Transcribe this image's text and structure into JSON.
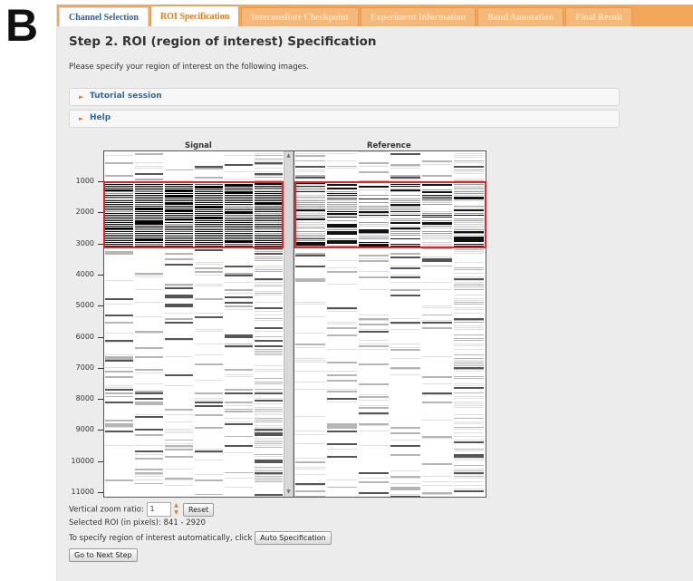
{
  "panel_label": "B",
  "tabs": [
    {
      "label": "Channel Selection"
    },
    {
      "label": "ROI Specification"
    },
    {
      "label": "Intermediate Checkpoint"
    },
    {
      "label": "Experiment Information"
    },
    {
      "label": "Band Annotation"
    },
    {
      "label": "Final Result"
    }
  ],
  "step_title": "Step 2. ROI (region of interest) Specification",
  "intro_text": "Please specify your region of interest on the following images.",
  "accordions": [
    {
      "label": "Tutorial session"
    },
    {
      "label": "Help"
    }
  ],
  "signal_title": "Signal",
  "reference_title": "Reference",
  "y_axis_ticks": [
    "1000",
    "2000",
    "3000",
    "4000",
    "5000",
    "6000",
    "7000",
    "8000",
    "9000",
    "10000",
    "11000"
  ],
  "zoom": {
    "label": "Vertical zoom ratio:",
    "value": "1",
    "reset_label": "Reset"
  },
  "selected_roi": "Selected ROI (in pixels): 841 - 2920",
  "auto_spec": {
    "text": "To specify region of interest automatically, click",
    "button_label": "Auto Specification"
  },
  "next_button_label": "Go to Next Step",
  "colors": {
    "tab_bar": "#f2a65a",
    "active_tab_text": "#e07b1e",
    "link_blue": "#2a6aa5",
    "roi_red": "#e0262a"
  }
}
